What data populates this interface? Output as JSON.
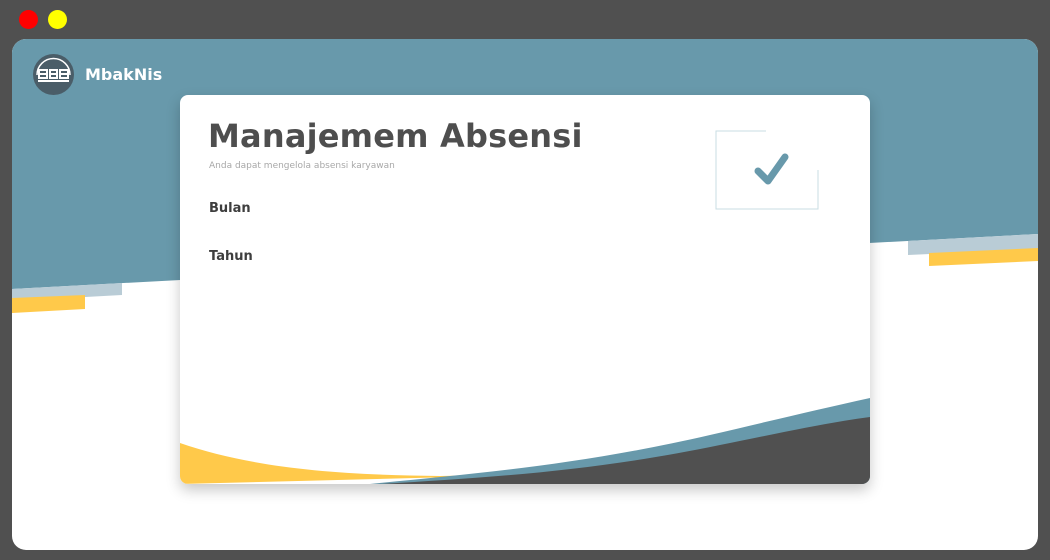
{
  "colors": {
    "background": "#505050",
    "primary": "#6899ab",
    "accent": "#ffc94a",
    "light_accent": "#b9ccd6",
    "dark": "#505050",
    "text": "#4e4e4e",
    "muted": "#a8a8a8"
  },
  "window_controls": [
    "close-dot",
    "minimize-dot"
  ],
  "brand": {
    "name": "MbakNis",
    "logo_icon": "building-logo-icon"
  },
  "card": {
    "title": "Manajemem Absensi",
    "subtitle": "Anda dapat mengelola absensi karyawan",
    "icon": "checkmark-icon",
    "fields": {
      "month_label": "Bulan",
      "year_label": "Tahun"
    }
  }
}
